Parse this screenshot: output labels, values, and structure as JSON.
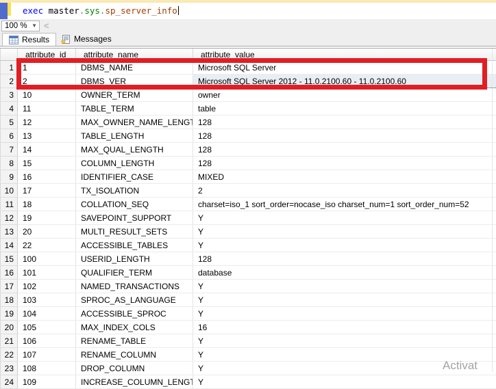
{
  "editor": {
    "query_tokens": [
      {
        "text": "exec ",
        "color": "#0000ff"
      },
      {
        "text": "master",
        "color": "#000000"
      },
      {
        "text": ".",
        "color": "#6e6e6e"
      },
      {
        "text": "sys",
        "color": "#008000"
      },
      {
        "text": ".",
        "color": "#6e6e6e"
      },
      {
        "text": "sp_server_info",
        "color": "#a33e00"
      }
    ]
  },
  "toolbar": {
    "zoom_level": "100 %",
    "scroll_left_arrow": "<"
  },
  "tabs": [
    {
      "label": "Results",
      "icon": "results-grid-icon",
      "active": true
    },
    {
      "label": "Messages",
      "icon": "messages-note-icon",
      "active": false
    }
  ],
  "grid": {
    "columns": [
      "attribute_id",
      "attribute_name",
      "attribute_value"
    ],
    "selected": {
      "row_index": 1,
      "col_index": 3
    },
    "rows": [
      [
        "1",
        "1",
        "DBMS_NAME",
        "Microsoft SQL Server"
      ],
      [
        "2",
        "2",
        "DBMS_VER",
        "Microsoft SQL Server 2012 - 11.0.2100.60 - 11.0.2100.60"
      ],
      [
        "3",
        "10",
        "OWNER_TERM",
        "owner"
      ],
      [
        "4",
        "11",
        "TABLE_TERM",
        "table"
      ],
      [
        "5",
        "12",
        "MAX_OWNER_NAME_LENGTH",
        "128"
      ],
      [
        "6",
        "13",
        "TABLE_LENGTH",
        "128"
      ],
      [
        "7",
        "14",
        "MAX_QUAL_LENGTH",
        "128"
      ],
      [
        "8",
        "15",
        "COLUMN_LENGTH",
        "128"
      ],
      [
        "9",
        "16",
        "IDENTIFIER_CASE",
        "MIXED"
      ],
      [
        "10",
        "17",
        "TX_ISOLATION",
        "2"
      ],
      [
        "11",
        "18",
        "COLLATION_SEQ",
        "charset=iso_1 sort_order=nocase_iso charset_num=1 sort_order_num=52"
      ],
      [
        "12",
        "19",
        "SAVEPOINT_SUPPORT",
        "Y"
      ],
      [
        "13",
        "20",
        "MULTI_RESULT_SETS",
        "Y"
      ],
      [
        "14",
        "22",
        "ACCESSIBLE_TABLES",
        "Y"
      ],
      [
        "15",
        "100",
        "USERID_LENGTH",
        "128"
      ],
      [
        "16",
        "101",
        "QUALIFIER_TERM",
        "database"
      ],
      [
        "17",
        "102",
        "NAMED_TRANSACTIONS",
        "Y"
      ],
      [
        "18",
        "103",
        "SPROC_AS_LANGUAGE",
        "Y"
      ],
      [
        "19",
        "104",
        "ACCESSIBLE_SPROC",
        "Y"
      ],
      [
        "20",
        "105",
        "MAX_INDEX_COLS",
        "16"
      ],
      [
        "21",
        "106",
        "RENAME_TABLE",
        "Y"
      ],
      [
        "22",
        "107",
        "RENAME_COLUMN",
        "Y"
      ],
      [
        "23",
        "108",
        "DROP_COLUMN",
        "Y"
      ],
      [
        "24",
        "109",
        "INCREASE_COLUMN_LENGTH",
        "Y"
      ]
    ]
  },
  "watermark": {
    "text": "Activat"
  },
  "colors": {
    "highlight_box": "#e21e25",
    "selected_cell_bg": "#e8eef4",
    "change_bar_yellow": "#fde14d",
    "editor_margin_blue": "#4f6bcd",
    "top_band_cream": "#fae9b3",
    "panel_gray": "#efefef"
  }
}
